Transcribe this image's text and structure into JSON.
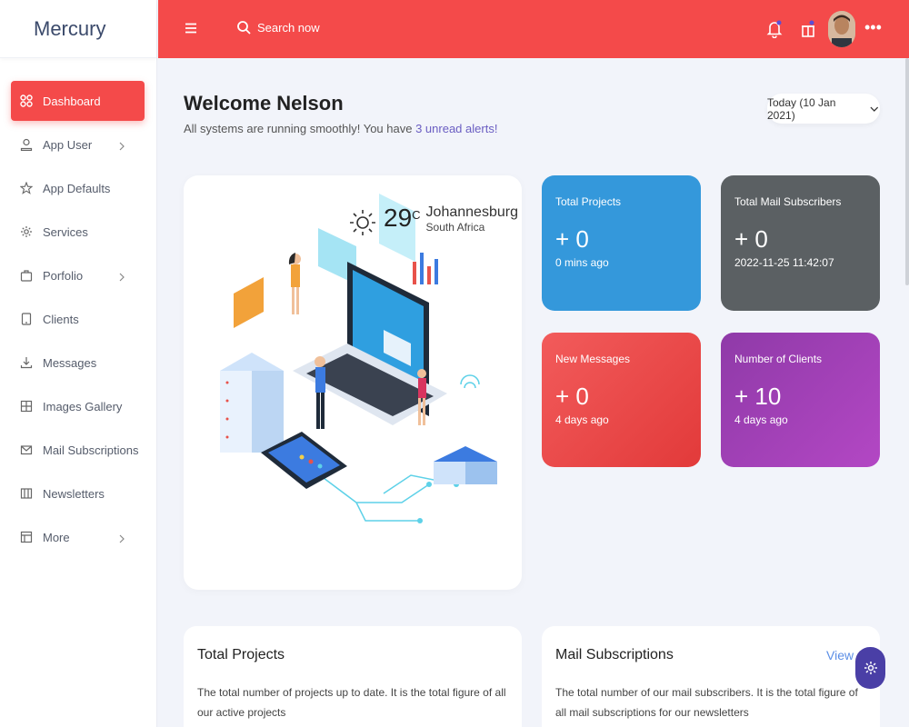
{
  "app": {
    "brand": "Mercury"
  },
  "sidebar": {
    "items": [
      {
        "label": "Dashboard",
        "icon": "grid-icon",
        "active": true,
        "has_arrow": false
      },
      {
        "label": "App User",
        "icon": "user-icon",
        "active": false,
        "has_arrow": true
      },
      {
        "label": "App Defaults",
        "icon": "star-icon",
        "active": false,
        "has_arrow": false
      },
      {
        "label": "Services",
        "icon": "gear-icon",
        "active": false,
        "has_arrow": false
      },
      {
        "label": "Porfolio",
        "icon": "briefcase-icon",
        "active": false,
        "has_arrow": true
      },
      {
        "label": "Clients",
        "icon": "tablet-icon",
        "active": false,
        "has_arrow": false
      },
      {
        "label": "Messages",
        "icon": "download-icon",
        "active": false,
        "has_arrow": false
      },
      {
        "label": "Images Gallery",
        "icon": "grid-square-icon",
        "active": false,
        "has_arrow": false
      },
      {
        "label": "Mail Subscriptions",
        "icon": "mail-icon",
        "active": false,
        "has_arrow": false
      },
      {
        "label": "Newsletters",
        "icon": "columns-icon",
        "active": false,
        "has_arrow": false
      },
      {
        "label": "More",
        "icon": "layout-icon",
        "active": false,
        "has_arrow": true
      }
    ]
  },
  "header": {
    "search_placeholder": "Search now",
    "more_symbol": "•••"
  },
  "main": {
    "welcome_title": "Welcome Nelson",
    "welcome_sub_prefix": "All systems are running smoothly! You have ",
    "welcome_sub_link": "3 unread alerts!",
    "date_label": "Today (10 Jan 2021)",
    "weather": {
      "temp": "29",
      "unit": "C",
      "city": "Johannesburg",
      "country": "South Africa"
    }
  },
  "stats": [
    {
      "label": "Total Projects",
      "value": "+ 0",
      "time": "0 mins ago",
      "color": "#3498db"
    },
    {
      "label": "Total Mail Subscribers",
      "value": "+ 0",
      "time": "2022-11-25 11:42:07",
      "color": "#5b6063"
    },
    {
      "label": "New Messages",
      "value": "+ 0",
      "time": "4 days ago",
      "color": "#e84545"
    },
    {
      "label": "Number of Clients",
      "value": "+ 10",
      "time": "4 days ago",
      "color": "#a441b8"
    }
  ],
  "info_cards": [
    {
      "title": "Total Projects",
      "desc": "The total number of projects up to date. It is the total figure of all our active projects",
      "link": ""
    },
    {
      "title": "Mail Subscriptions",
      "desc": "The total number of our mail subscribers. It is the total figure of all mail subscriptions for our newsletters",
      "link": "View all"
    }
  ],
  "colors": {
    "accent": "#f44a4a",
    "background": "#f2f4fa",
    "fab": "#4a3fa6"
  }
}
